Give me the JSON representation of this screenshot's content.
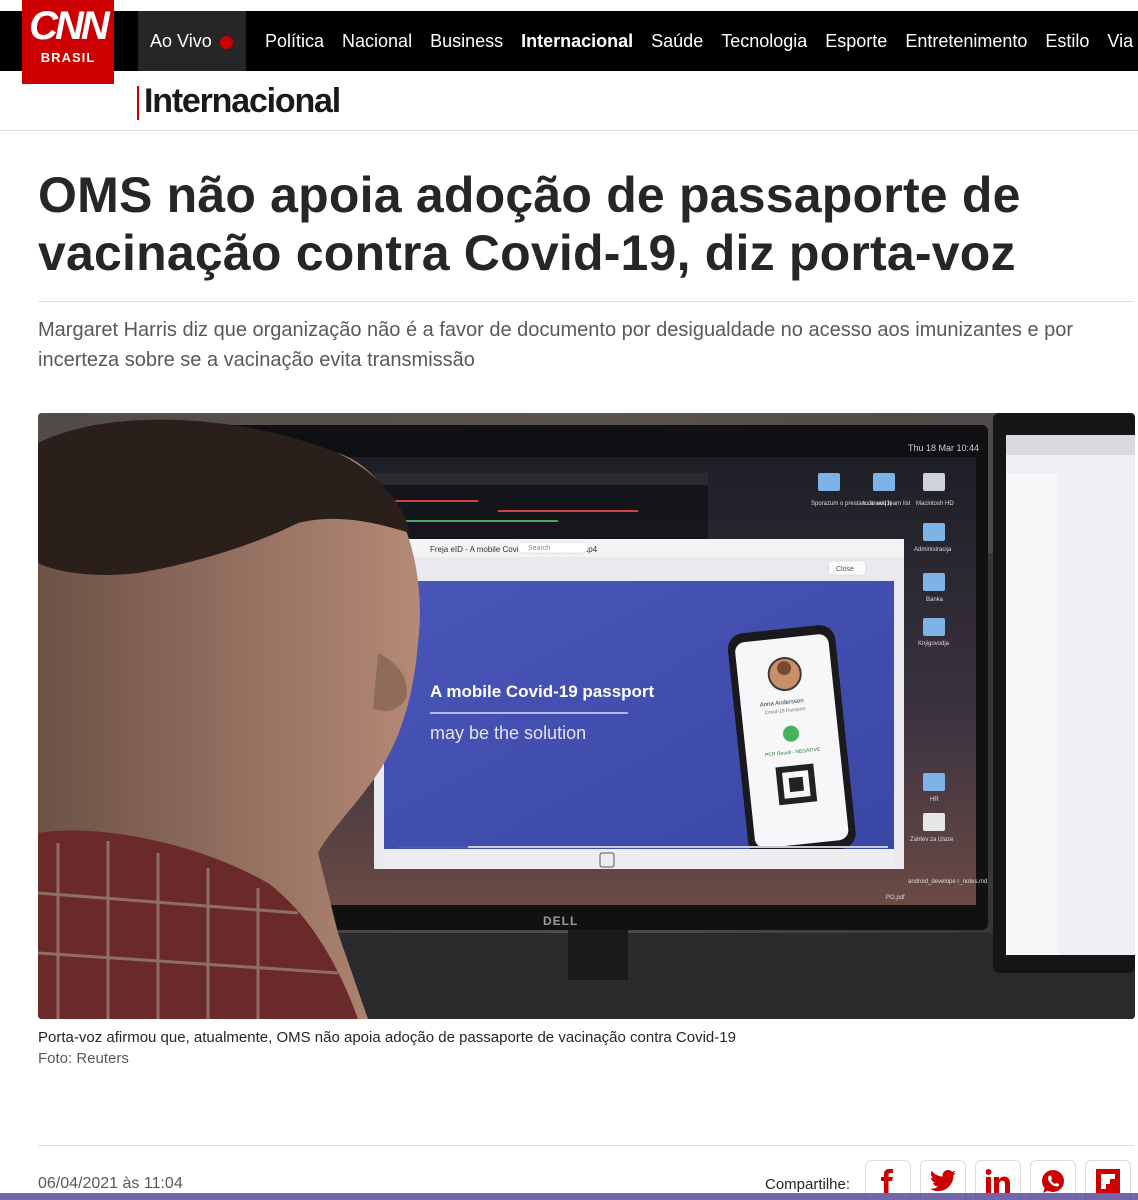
{
  "brand": {
    "logo_main": "CNN",
    "logo_sub": "BRASIL",
    "color": "#cc0000"
  },
  "live": {
    "label": "Ao Vivo"
  },
  "nav": {
    "items": [
      "Política",
      "Nacional",
      "Business",
      "Internacional",
      "Saúde",
      "Tecnologia",
      "Esporte",
      "Entretenimento",
      "Estilo",
      "Via"
    ],
    "active": "Internacional"
  },
  "section": {
    "title": "Internacional"
  },
  "article": {
    "headline": "OMS não apoia adoção de passaporte de vacinação contra Covid-19, diz porta-voz",
    "subtitle": "Margaret Harris diz que organização não é a favor de documento por desigualdade no acesso aos imunizantes e por incerteza sobre se a vacinação evita transmissão",
    "image": {
      "screen_title_line1": "A mobile Covid-19 passport",
      "screen_title_line2": "may be the solution",
      "monitor_brand": "DELL",
      "window_title": "Freja eID - A mobile Covid-19 passport (1).mp4",
      "close_label": "Close",
      "search_label": "Search",
      "phone_name": "Anna Andersson",
      "phone_subtitle": "Covid-19 Passport",
      "phone_result": "PCR Result - NEGATIVE",
      "desktop_icons": [
        "Sporazum o prestan...anovi(1)",
        "todo and learn list",
        "Macintosh HD",
        "Administracija",
        "Banka",
        "Knjigovodja",
        "HR",
        "Zahtev za izlaze",
        "android_develope r_notes.md",
        "PO.pdf"
      ],
      "menu_clock": "Thu 18 Mar 10:44"
    },
    "caption": "Porta-voz afirmou que, atualmente, OMS não apoia adoção de passaporte de vacinação contra Covid-19",
    "credit": "Foto: Reuters",
    "date": "06/04/2021 às 11:04"
  },
  "share": {
    "label": "Compartilhe:",
    "buttons": [
      "facebook-icon",
      "twitter-icon",
      "linkedin-icon",
      "whatsapp-icon",
      "flipboard-icon"
    ],
    "icon_color": "#cc0000"
  }
}
